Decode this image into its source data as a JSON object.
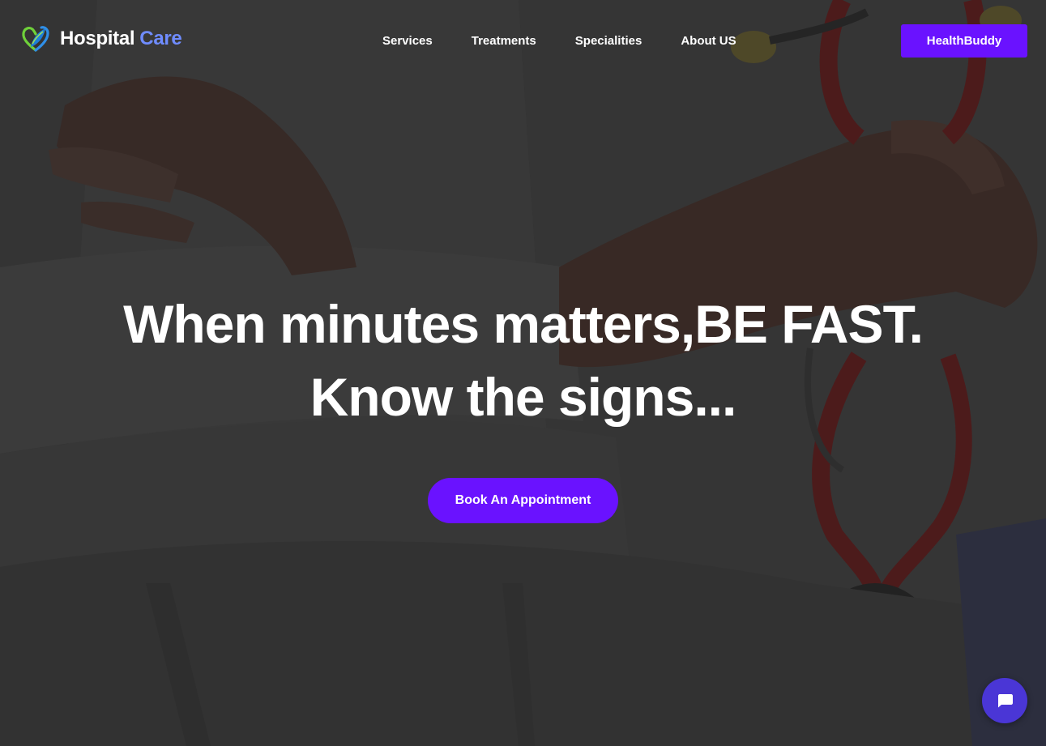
{
  "brand": {
    "name_part1": "Hospital",
    "name_part2": "Care",
    "logo_icon": "heart-leaf-logo-icon"
  },
  "nav": {
    "links": [
      {
        "label": "Services"
      },
      {
        "label": "Treatments"
      },
      {
        "label": "Specialities"
      },
      {
        "label": "About US"
      }
    ],
    "cta_label": "HealthBuddy"
  },
  "hero": {
    "headline_line1": "When minutes matters,BE FAST.",
    "headline_line2": "Know the signs...",
    "button_label": "Book An Appointment",
    "background_image": "doctor-with-stethoscope-photo"
  },
  "chat": {
    "icon": "chat-bubble-icon"
  },
  "colors": {
    "accent": "#6a12ff",
    "brand_blue": "#6f8cff",
    "chat_fab": "#4a36d6",
    "text": "#ffffff"
  }
}
